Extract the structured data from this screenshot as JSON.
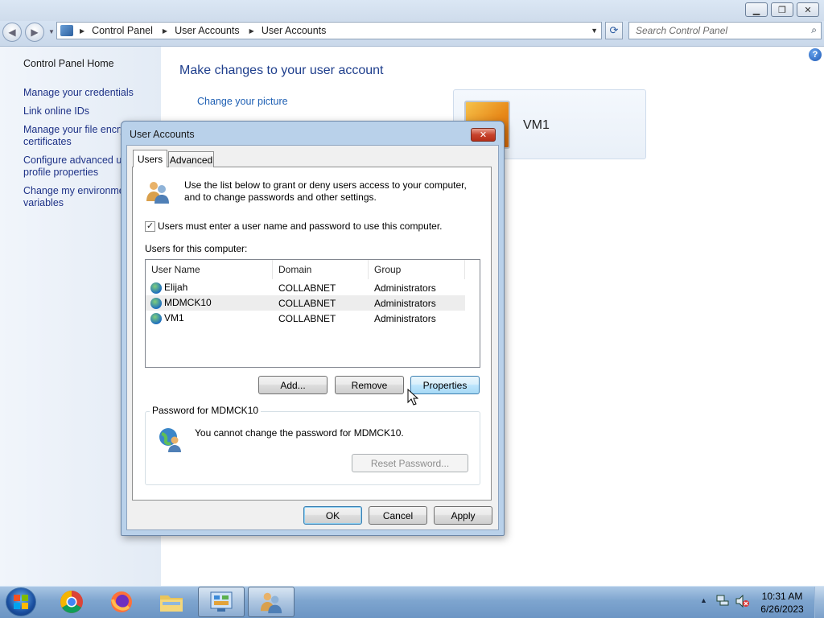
{
  "explorer": {
    "breadcrumb": [
      "Control Panel",
      "User Accounts",
      "User Accounts"
    ],
    "search_placeholder": "Search Control Panel"
  },
  "sidebar": {
    "items": [
      {
        "label": "Control Panel Home"
      },
      {
        "label": "Manage your credentials"
      },
      {
        "label": "Link online IDs"
      },
      {
        "label": "Manage your file encry",
        "label2": "certificates"
      },
      {
        "label": "Configure advanced us",
        "label2": "profile properties"
      },
      {
        "label": "Change my environme",
        "label2": "variables"
      }
    ]
  },
  "main": {
    "heading": "Make changes to your user account",
    "change_picture": "Change your picture",
    "account_name": "VM1"
  },
  "dialog": {
    "title": "User Accounts",
    "close_glyph": "✕",
    "tabs": [
      {
        "label": "Users"
      },
      {
        "label": "Advanced"
      }
    ],
    "intro": [
      "Use the list below to grant or deny users access to your computer,",
      "and to change passwords and other settings."
    ],
    "checkbox_label": "Users must enter a user name and password to use this computer.",
    "checkbox_checked": true,
    "users_label": "Users for this computer:",
    "columns": [
      "User Name",
      "Domain",
      "Group"
    ],
    "users": [
      {
        "name": "Elijah",
        "domain": "COLLABNET",
        "group": "Administrators"
      },
      {
        "name": "MDMCK10",
        "domain": "COLLABNET",
        "group": "Administrators"
      },
      {
        "name": "VM1",
        "domain": "COLLABNET",
        "group": "Administrators"
      }
    ],
    "add_label": "Add...",
    "remove_label": "Remove",
    "properties_label": "Properties",
    "password_group": "Password for MDMCK10",
    "password_msg": "You cannot change the password for MDMCK10.",
    "reset_label": "Reset Password...",
    "ok_label": "OK",
    "cancel_label": "Cancel",
    "apply_label": "Apply"
  },
  "taskbar": {
    "time": "10:31 AM",
    "date": "6/26/2023",
    "apps": [
      "chrome-icon",
      "firefox-icon",
      "file-explorer-icon",
      "control-panel-icon",
      "user-accounts-icon"
    ]
  }
}
